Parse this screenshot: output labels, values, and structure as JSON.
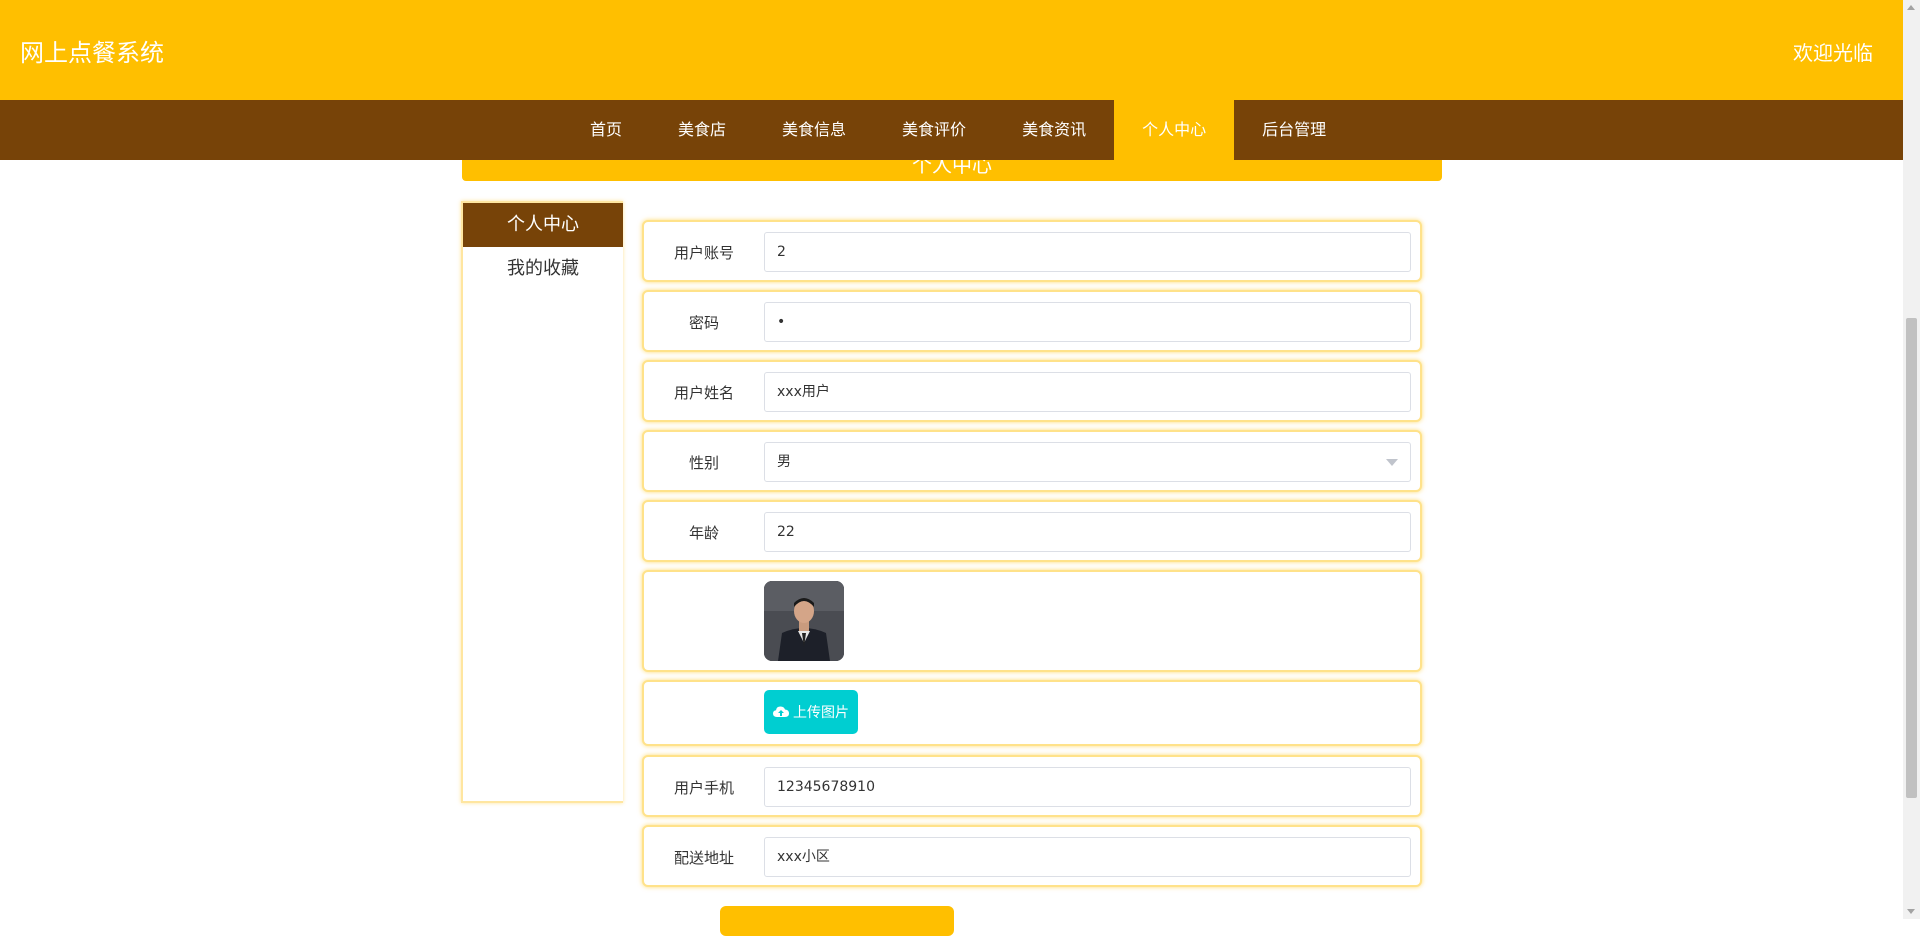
{
  "header": {
    "title": "网上点餐系统",
    "welcome": "欢迎光临"
  },
  "nav": {
    "items": [
      {
        "label": "首页"
      },
      {
        "label": "美食店"
      },
      {
        "label": "美食信息"
      },
      {
        "label": "美食评价"
      },
      {
        "label": "美食资讯"
      },
      {
        "label": "个人中心",
        "active": true
      },
      {
        "label": "后台管理"
      }
    ]
  },
  "banner": {
    "title": "个人中心"
  },
  "sidebar": {
    "items": [
      {
        "label": "个人中心",
        "active": true
      },
      {
        "label": "我的收藏"
      }
    ]
  },
  "form": {
    "account": {
      "label": "用户账号",
      "value": "2"
    },
    "password": {
      "label": "密码",
      "value": "•"
    },
    "name": {
      "label": "用户姓名",
      "value": "xxx用户"
    },
    "gender": {
      "label": "性别",
      "value": "男"
    },
    "age": {
      "label": "年龄",
      "value": "22"
    },
    "upload_label": "上传图片",
    "phone": {
      "label": "用户手机",
      "value": "12345678910"
    },
    "address": {
      "label": "配送地址",
      "value": "xxx小区"
    }
  },
  "colors": {
    "primary": "#FFBF00",
    "nav_bg": "#774308",
    "upload_btn": "#00CED1"
  },
  "icons": {
    "upload": "cloud-upload-icon",
    "dropdown": "chevron-down-icon"
  }
}
